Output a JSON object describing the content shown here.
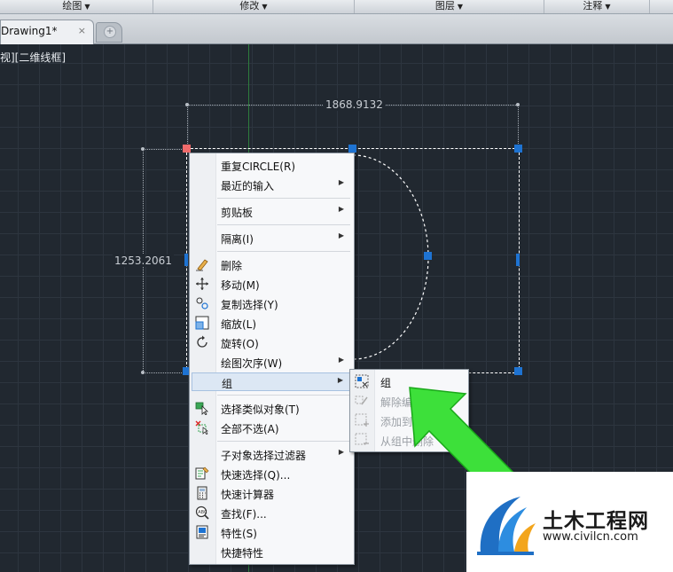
{
  "ribbon": {
    "panels": [
      "绘图",
      "修改",
      "图层",
      "注释"
    ]
  },
  "tabs": {
    "document": "Drawing1*",
    "close": "×",
    "new": "+"
  },
  "viewport": {
    "label": "视][二维线框]"
  },
  "dimensions": {
    "width": "1868.9132",
    "height": "1253.2061"
  },
  "context_menu": {
    "items": [
      {
        "label": "重复CIRCLE(R)",
        "submenu": false,
        "icon": ""
      },
      {
        "label": "最近的输入",
        "submenu": true,
        "icon": ""
      },
      {
        "label": "剪贴板",
        "submenu": true,
        "icon": ""
      },
      {
        "label": "隔离(I)",
        "submenu": true,
        "icon": ""
      },
      {
        "label": "删除",
        "submenu": false,
        "icon": "eraser-icon"
      },
      {
        "label": "移动(M)",
        "submenu": false,
        "icon": "move-icon"
      },
      {
        "label": "复制选择(Y)",
        "submenu": false,
        "icon": "copy-icon"
      },
      {
        "label": "缩放(L)",
        "submenu": false,
        "icon": "scale-icon"
      },
      {
        "label": "旋转(O)",
        "submenu": false,
        "icon": "rotate-icon"
      },
      {
        "label": "绘图次序(W)",
        "submenu": true,
        "icon": ""
      },
      {
        "label": "组",
        "submenu": true,
        "icon": "",
        "highlighted": true
      },
      {
        "label": "选择类似对象(T)",
        "submenu": false,
        "icon": "select-similar-icon"
      },
      {
        "label": "全部不选(A)",
        "submenu": false,
        "icon": "deselect-icon"
      },
      {
        "label": "子对象选择过滤器",
        "submenu": true,
        "icon": ""
      },
      {
        "label": "快速选择(Q)...",
        "submenu": false,
        "icon": "quick-select-icon"
      },
      {
        "label": "快速计算器",
        "submenu": false,
        "icon": "calculator-icon"
      },
      {
        "label": "查找(F)...",
        "submenu": false,
        "icon": "find-icon"
      },
      {
        "label": "特性(S)",
        "submenu": false,
        "icon": "properties-icon"
      },
      {
        "label": "快捷特性",
        "submenu": false,
        "icon": ""
      }
    ]
  },
  "group_submenu": {
    "items": [
      {
        "label": "组",
        "enabled": true,
        "icon": "group-icon"
      },
      {
        "label": "解除编",
        "enabled": false,
        "icon": "ungroup-icon"
      },
      {
        "label": "添加到组",
        "enabled": false,
        "icon": "add-to-group-icon"
      },
      {
        "label": "从组中删除",
        "enabled": false,
        "icon": "remove-from-group-icon"
      }
    ]
  },
  "watermark": {
    "brand": "土木工程网",
    "url": "www.civilcn.com"
  },
  "colors": {
    "canvas": "#212830",
    "grip": "#1e73d2",
    "grip_hot": "#f06b6b",
    "arrow": "#3de03a",
    "menu_highlight": "#dce7f4"
  }
}
